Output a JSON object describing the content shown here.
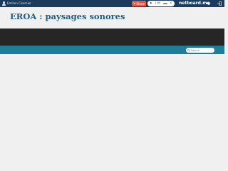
{
  "topbar": {
    "user_name": "Emilien Cisernier",
    "share_label": "Share",
    "player": {
      "time": "1:00",
      "count": "0"
    },
    "brand": "netboard.me"
  },
  "page": {
    "title": "EROA : paysages sonores"
  },
  "search": {
    "placeholder": "Search"
  },
  "colors": {
    "topbar": "#1c3a5c",
    "share": "#e05a47",
    "darkband": "#262626",
    "navbar": "#1e7e98",
    "title": "#1c5f82",
    "background": "#f0f0f0"
  },
  "icons": [
    "user-icon",
    "share-icon",
    "play-icon",
    "volume-icon",
    "login-icon",
    "search-icon"
  ]
}
